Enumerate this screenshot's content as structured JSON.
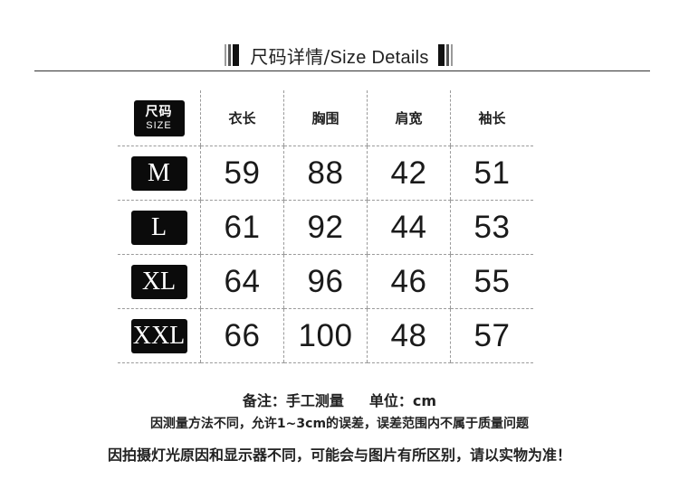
{
  "header": {
    "title_zh": "尺码详情/",
    "title_en": "Size Details"
  },
  "table": {
    "corner_zh": "尺码",
    "corner_en": "SIZE",
    "columns": [
      "衣长",
      "胸围",
      "肩宽",
      "袖长"
    ],
    "rows": [
      {
        "size": "M",
        "values": [
          "59",
          "88",
          "42",
          "51"
        ]
      },
      {
        "size": "L",
        "values": [
          "61",
          "92",
          "44",
          "53"
        ]
      },
      {
        "size": "XL",
        "values": [
          "64",
          "96",
          "46",
          "55"
        ]
      },
      {
        "size": "XXL",
        "values": [
          "66",
          "100",
          "48",
          "57"
        ]
      }
    ]
  },
  "notes": {
    "remark": "备注：手工测量",
    "unit": "单位：cm",
    "error_note": "因测量方法不同，允许1~3cm的误差，误差范围内不属于质量问题",
    "photo_note": "因拍摄灯光原因和显示器不同，可能会与图片有所区别，请以实物为准！"
  }
}
